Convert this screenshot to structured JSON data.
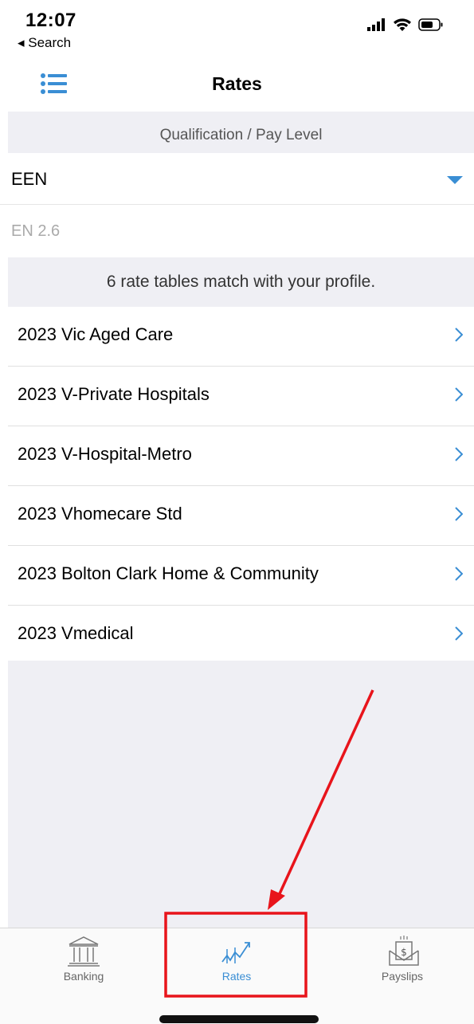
{
  "status_bar": {
    "time": "12:07",
    "back_label": "◂ Search",
    "icons": [
      "signal-icon",
      "wifi-icon",
      "battery-icon"
    ]
  },
  "nav": {
    "title": "Rates",
    "menu_icon": "list-icon"
  },
  "qualification": {
    "header": "Qualification / Pay Level",
    "selected": "EEN",
    "level": "EN 2.6"
  },
  "rates": {
    "match_text": "6 rate tables match with your profile.",
    "items": [
      {
        "label": "2023 Vic Aged Care"
      },
      {
        "label": "2023 V-Private Hospitals"
      },
      {
        "label": "2023 V-Hospital-Metro"
      },
      {
        "label": "2023 Vhomecare Std"
      },
      {
        "label": "2023 Bolton Clark Home & Community"
      },
      {
        "label": "2023 Vmedical"
      }
    ]
  },
  "tabs": [
    {
      "label": "Banking",
      "icon": "bank-icon",
      "active": false
    },
    {
      "label": "Rates",
      "icon": "rates-chart-icon",
      "active": true
    },
    {
      "label": "Payslips",
      "icon": "payslip-envelope-icon",
      "active": false
    }
  ],
  "colors": {
    "accent": "#3a8ed4",
    "section_bg": "#efeff4",
    "annotation": "#e8141b"
  }
}
